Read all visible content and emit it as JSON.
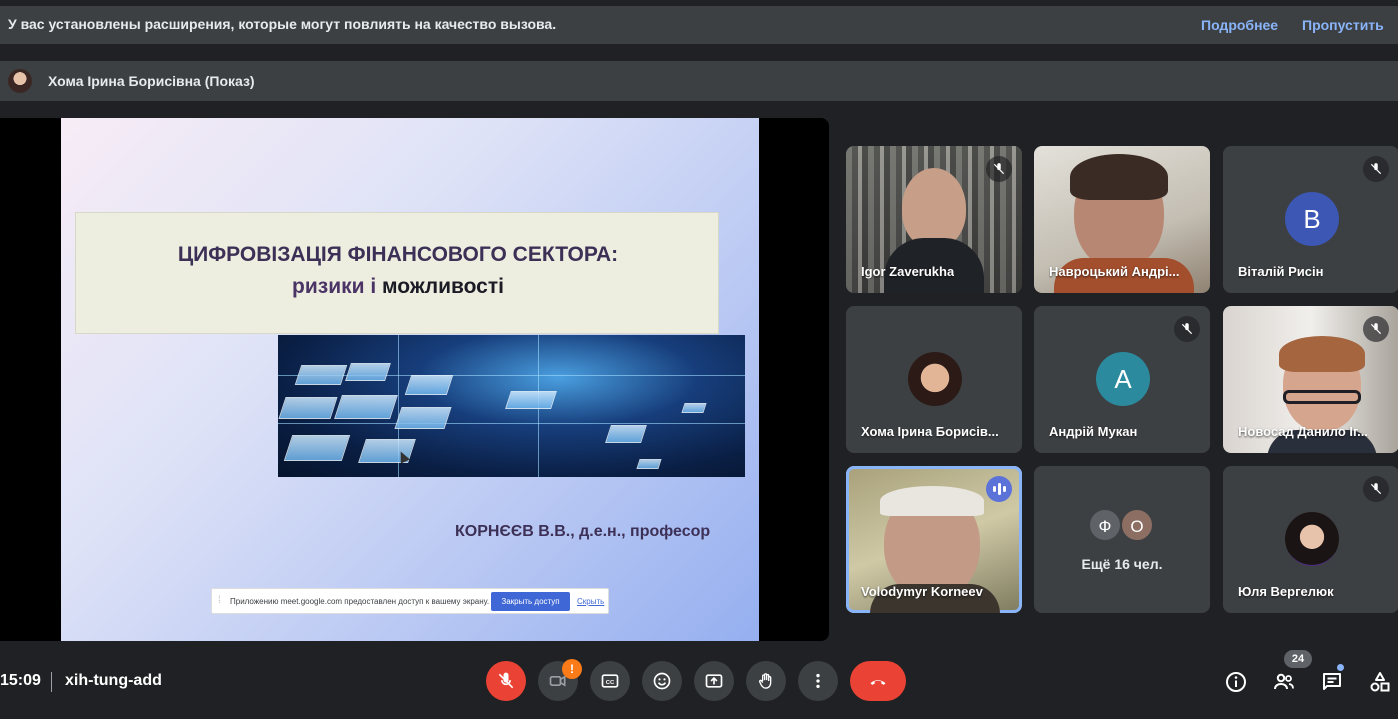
{
  "banner": {
    "message": "У вас установлены расширения, которые могут повлиять на качество вызова.",
    "more_link": "Подробнее",
    "skip_link": "Пропустить"
  },
  "presenter": {
    "name": "Хома Ірина Борисівна (Показ)"
  },
  "slide": {
    "title_line1": "ЦИФРОВІЗАЦІЯ ФІНАНСОВОГО СЕКТОРА:",
    "title_line2_part1": "ризики і ",
    "title_line2_part2": "можливості",
    "author": "КОРНЄЄВ В.В., д.е.н., професор",
    "share_notice": "Приложению meet.google.com предоставлен доступ к вашему экрану.",
    "share_stop": "Закрыть доступ",
    "share_hide": "Скрыть"
  },
  "participants": [
    {
      "name": "Igor Zaverukha",
      "muted": true
    },
    {
      "name": "Навроцький Андрі...",
      "muted": false
    },
    {
      "name": "Віталій Рисін",
      "muted": true,
      "initial": "В",
      "color": "#3c57b4"
    },
    {
      "name": "Хома Ірина Борисів...",
      "muted": false
    },
    {
      "name": "Андрій Мукан",
      "muted": true,
      "initial": "А",
      "color": "#2b8a9e"
    },
    {
      "name": "Новосад Данило Іг...",
      "muted": true
    },
    {
      "name": "Volodymyr Korneev",
      "speaking": true
    },
    {
      "others_label": "Ещё 16 чел.",
      "initials": [
        "Ф",
        "О"
      ],
      "colors": [
        "#5f6368",
        "#8d6e63"
      ]
    },
    {
      "name": "Юля Вергелюк",
      "muted": true
    }
  ],
  "footer": {
    "time": "15:09",
    "meeting_code": "xih-tung-add",
    "camera_warning": "!",
    "participant_count": "24"
  },
  "icons": {
    "mic": "mic-off-icon",
    "camera": "camera-icon",
    "captions": "captions-icon",
    "emoji": "emoji-icon",
    "present": "present-screen-icon",
    "hand": "raise-hand-icon",
    "more": "more-options-icon",
    "leave": "leave-call-icon",
    "info": "info-icon",
    "people": "people-icon",
    "chat": "chat-icon",
    "activities": "activities-icon"
  }
}
